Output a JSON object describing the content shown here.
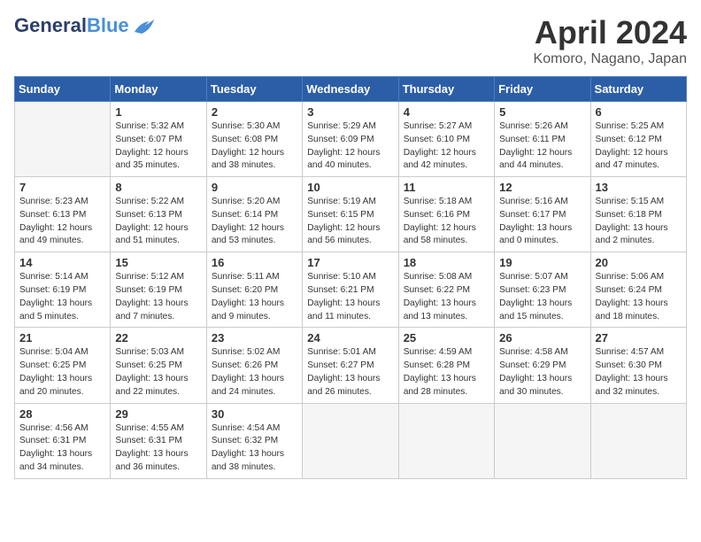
{
  "header": {
    "logo_general": "General",
    "logo_blue": "Blue",
    "month_title": "April 2024",
    "location": "Komoro, Nagano, Japan"
  },
  "weekdays": [
    "Sunday",
    "Monday",
    "Tuesday",
    "Wednesday",
    "Thursday",
    "Friday",
    "Saturday"
  ],
  "weeks": [
    [
      {
        "day": "",
        "info": ""
      },
      {
        "day": "1",
        "info": "Sunrise: 5:32 AM\nSunset: 6:07 PM\nDaylight: 12 hours\nand 35 minutes."
      },
      {
        "day": "2",
        "info": "Sunrise: 5:30 AM\nSunset: 6:08 PM\nDaylight: 12 hours\nand 38 minutes."
      },
      {
        "day": "3",
        "info": "Sunrise: 5:29 AM\nSunset: 6:09 PM\nDaylight: 12 hours\nand 40 minutes."
      },
      {
        "day": "4",
        "info": "Sunrise: 5:27 AM\nSunset: 6:10 PM\nDaylight: 12 hours\nand 42 minutes."
      },
      {
        "day": "5",
        "info": "Sunrise: 5:26 AM\nSunset: 6:11 PM\nDaylight: 12 hours\nand 44 minutes."
      },
      {
        "day": "6",
        "info": "Sunrise: 5:25 AM\nSunset: 6:12 PM\nDaylight: 12 hours\nand 47 minutes."
      }
    ],
    [
      {
        "day": "7",
        "info": "Sunrise: 5:23 AM\nSunset: 6:13 PM\nDaylight: 12 hours\nand 49 minutes."
      },
      {
        "day": "8",
        "info": "Sunrise: 5:22 AM\nSunset: 6:13 PM\nDaylight: 12 hours\nand 51 minutes."
      },
      {
        "day": "9",
        "info": "Sunrise: 5:20 AM\nSunset: 6:14 PM\nDaylight: 12 hours\nand 53 minutes."
      },
      {
        "day": "10",
        "info": "Sunrise: 5:19 AM\nSunset: 6:15 PM\nDaylight: 12 hours\nand 56 minutes."
      },
      {
        "day": "11",
        "info": "Sunrise: 5:18 AM\nSunset: 6:16 PM\nDaylight: 12 hours\nand 58 minutes."
      },
      {
        "day": "12",
        "info": "Sunrise: 5:16 AM\nSunset: 6:17 PM\nDaylight: 13 hours\nand 0 minutes."
      },
      {
        "day": "13",
        "info": "Sunrise: 5:15 AM\nSunset: 6:18 PM\nDaylight: 13 hours\nand 2 minutes."
      }
    ],
    [
      {
        "day": "14",
        "info": "Sunrise: 5:14 AM\nSunset: 6:19 PM\nDaylight: 13 hours\nand 5 minutes."
      },
      {
        "day": "15",
        "info": "Sunrise: 5:12 AM\nSunset: 6:19 PM\nDaylight: 13 hours\nand 7 minutes."
      },
      {
        "day": "16",
        "info": "Sunrise: 5:11 AM\nSunset: 6:20 PM\nDaylight: 13 hours\nand 9 minutes."
      },
      {
        "day": "17",
        "info": "Sunrise: 5:10 AM\nSunset: 6:21 PM\nDaylight: 13 hours\nand 11 minutes."
      },
      {
        "day": "18",
        "info": "Sunrise: 5:08 AM\nSunset: 6:22 PM\nDaylight: 13 hours\nand 13 minutes."
      },
      {
        "day": "19",
        "info": "Sunrise: 5:07 AM\nSunset: 6:23 PM\nDaylight: 13 hours\nand 15 minutes."
      },
      {
        "day": "20",
        "info": "Sunrise: 5:06 AM\nSunset: 6:24 PM\nDaylight: 13 hours\nand 18 minutes."
      }
    ],
    [
      {
        "day": "21",
        "info": "Sunrise: 5:04 AM\nSunset: 6:25 PM\nDaylight: 13 hours\nand 20 minutes."
      },
      {
        "day": "22",
        "info": "Sunrise: 5:03 AM\nSunset: 6:25 PM\nDaylight: 13 hours\nand 22 minutes."
      },
      {
        "day": "23",
        "info": "Sunrise: 5:02 AM\nSunset: 6:26 PM\nDaylight: 13 hours\nand 24 minutes."
      },
      {
        "day": "24",
        "info": "Sunrise: 5:01 AM\nSunset: 6:27 PM\nDaylight: 13 hours\nand 26 minutes."
      },
      {
        "day": "25",
        "info": "Sunrise: 4:59 AM\nSunset: 6:28 PM\nDaylight: 13 hours\nand 28 minutes."
      },
      {
        "day": "26",
        "info": "Sunrise: 4:58 AM\nSunset: 6:29 PM\nDaylight: 13 hours\nand 30 minutes."
      },
      {
        "day": "27",
        "info": "Sunrise: 4:57 AM\nSunset: 6:30 PM\nDaylight: 13 hours\nand 32 minutes."
      }
    ],
    [
      {
        "day": "28",
        "info": "Sunrise: 4:56 AM\nSunset: 6:31 PM\nDaylight: 13 hours\nand 34 minutes."
      },
      {
        "day": "29",
        "info": "Sunrise: 4:55 AM\nSunset: 6:31 PM\nDaylight: 13 hours\nand 36 minutes."
      },
      {
        "day": "30",
        "info": "Sunrise: 4:54 AM\nSunset: 6:32 PM\nDaylight: 13 hours\nand 38 minutes."
      },
      {
        "day": "",
        "info": ""
      },
      {
        "day": "",
        "info": ""
      },
      {
        "day": "",
        "info": ""
      },
      {
        "day": "",
        "info": ""
      }
    ]
  ]
}
